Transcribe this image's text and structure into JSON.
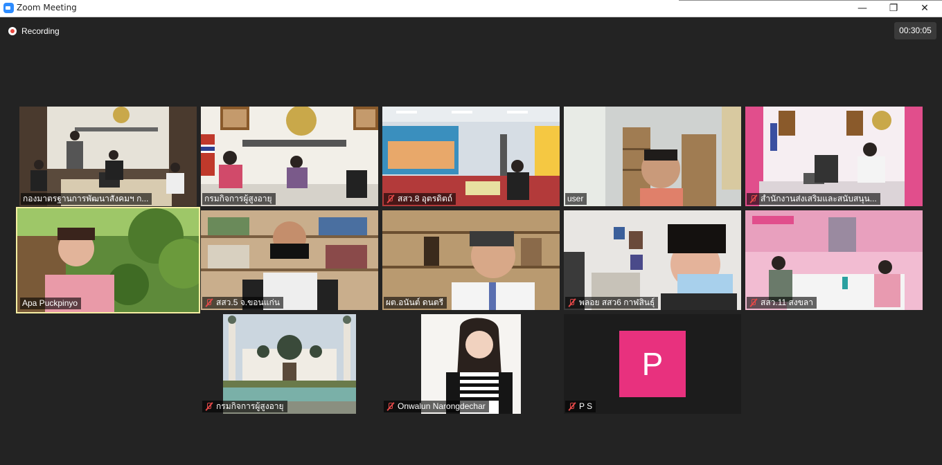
{
  "window": {
    "title": "Zoom Meeting",
    "minimize": "—",
    "restore": "❐",
    "close": "✕"
  },
  "recording": {
    "label": "Recording"
  },
  "timer": "00:30:05",
  "participants": [
    {
      "name": "กองมาตรฐานการพัฒนาสังคมฯ ก...",
      "muted": false
    },
    {
      "name": "กรมกิจการผู้สูงอายุ",
      "muted": false
    },
    {
      "name": "สสว.8 อุตรดิตถ์",
      "muted": true
    },
    {
      "name": "user",
      "muted": false
    },
    {
      "name": "สำนักงานส่งเสริมและสนับสนุน...",
      "muted": true
    },
    {
      "name": "Apa Puckpinyo",
      "muted": false,
      "active": true
    },
    {
      "name": "สสว.5 จ.ขอนแก่น",
      "muted": true
    },
    {
      "name": "ผต.อนันต์ ดนตรี",
      "muted": false
    },
    {
      "name": "พลอย สสว6 กาฬสินธุ์",
      "muted": true
    },
    {
      "name": "สสว.11 สงขลา",
      "muted": true
    },
    {
      "name": "กรมกิจการผู้สูงอายุ",
      "muted": true
    },
    {
      "name": "Onwalun Narongdechar",
      "muted": true
    },
    {
      "name": "P S",
      "muted": true,
      "avatar_letter": "P",
      "avatar_color": "#e8317e"
    }
  ],
  "colors": {
    "background": "#232323",
    "active_speaker": "#f5eea2",
    "muted_icon": "#e34848"
  }
}
